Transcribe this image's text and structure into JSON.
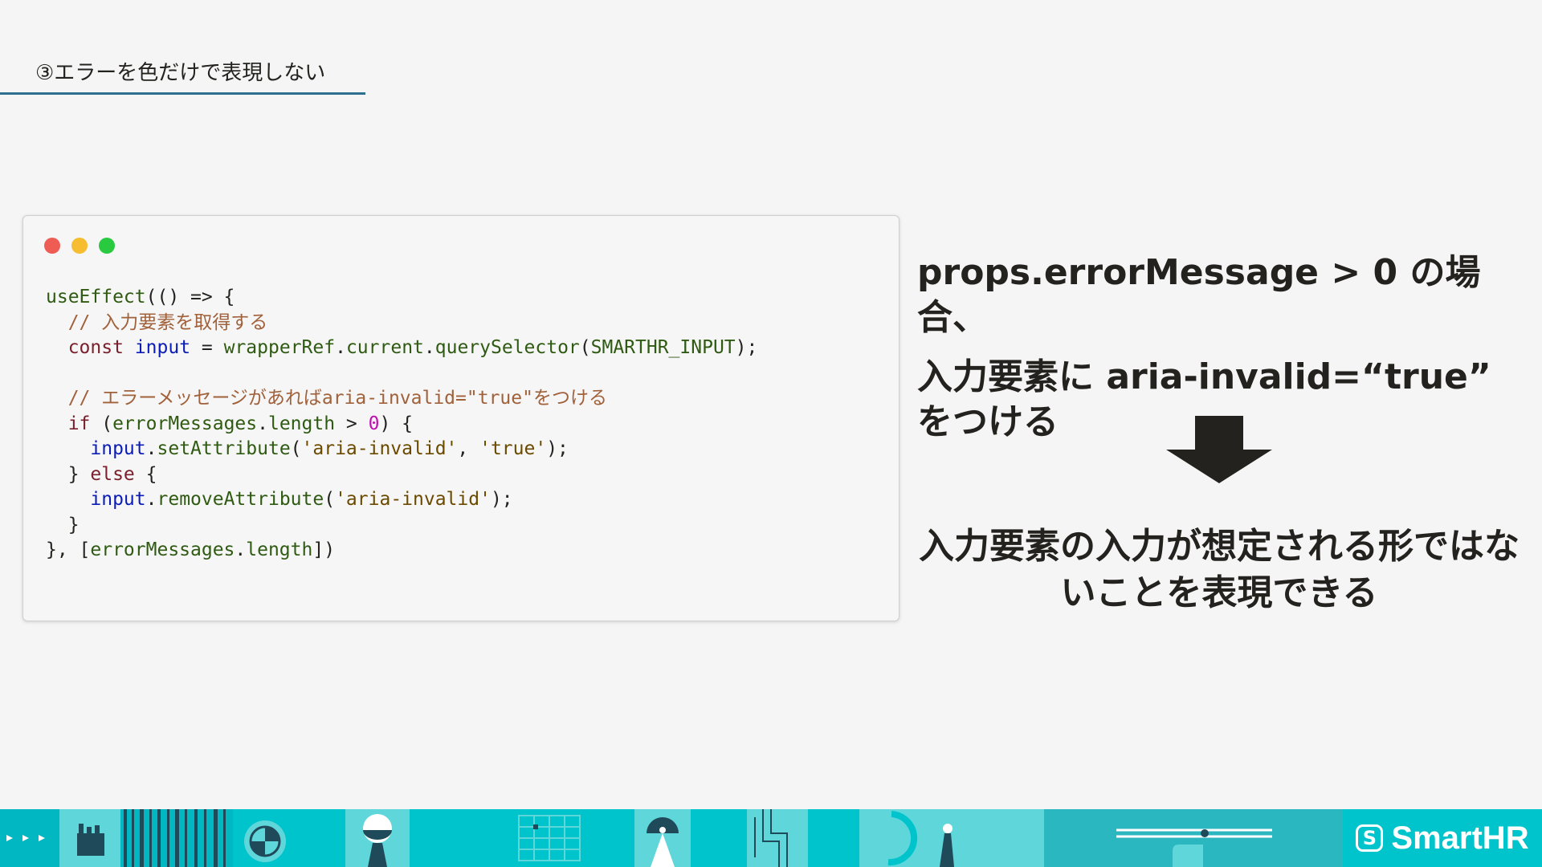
{
  "slide": {
    "section_title": "③エラーを色だけで表現しない"
  },
  "code_window": {
    "lines": [
      [
        {
          "t": "useEffect",
          "c": "fn"
        },
        {
          "t": "(() => {",
          "c": ""
        }
      ],
      [
        {
          "t": "  // 入力要素を取得する",
          "c": "cm"
        }
      ],
      [
        {
          "t": "  ",
          "c": ""
        },
        {
          "t": "const",
          "c": "kw"
        },
        {
          "t": " ",
          "c": ""
        },
        {
          "t": "input",
          "c": "var"
        },
        {
          "t": " = ",
          "c": ""
        },
        {
          "t": "wrapperRef",
          "c": "fn"
        },
        {
          "t": ".",
          "c": ""
        },
        {
          "t": "current",
          "c": "fn"
        },
        {
          "t": ".",
          "c": ""
        },
        {
          "t": "querySelector",
          "c": "fn"
        },
        {
          "t": "(",
          "c": ""
        },
        {
          "t": "SMARTHR_INPUT",
          "c": "fn"
        },
        {
          "t": ");",
          "c": ""
        }
      ],
      [
        {
          "t": "",
          "c": ""
        }
      ],
      [
        {
          "t": "  // エラーメッセージがあればaria-invalid=\"true\"をつける",
          "c": "cm"
        }
      ],
      [
        {
          "t": "  ",
          "c": ""
        },
        {
          "t": "if",
          "c": "kw"
        },
        {
          "t": " (",
          "c": ""
        },
        {
          "t": "errorMessages",
          "c": "fn"
        },
        {
          "t": ".",
          "c": ""
        },
        {
          "t": "length",
          "c": "fn"
        },
        {
          "t": " > ",
          "c": ""
        },
        {
          "t": "0",
          "c": "num"
        },
        {
          "t": ") {",
          "c": ""
        }
      ],
      [
        {
          "t": "    ",
          "c": ""
        },
        {
          "t": "input",
          "c": "var"
        },
        {
          "t": ".",
          "c": ""
        },
        {
          "t": "setAttribute",
          "c": "fn"
        },
        {
          "t": "(",
          "c": ""
        },
        {
          "t": "'aria-invalid'",
          "c": "str"
        },
        {
          "t": ", ",
          "c": ""
        },
        {
          "t": "'true'",
          "c": "str"
        },
        {
          "t": ");",
          "c": ""
        }
      ],
      [
        {
          "t": "  } ",
          "c": ""
        },
        {
          "t": "else",
          "c": "kw"
        },
        {
          "t": " {",
          "c": ""
        }
      ],
      [
        {
          "t": "    ",
          "c": ""
        },
        {
          "t": "input",
          "c": "var"
        },
        {
          "t": ".",
          "c": ""
        },
        {
          "t": "removeAttribute",
          "c": "fn"
        },
        {
          "t": "(",
          "c": ""
        },
        {
          "t": "'aria-invalid'",
          "c": "str"
        },
        {
          "t": ");",
          "c": ""
        }
      ],
      [
        {
          "t": "  }",
          "c": ""
        }
      ],
      [
        {
          "t": "}, [",
          "c": ""
        },
        {
          "t": "errorMessages",
          "c": "fn"
        },
        {
          "t": ".",
          "c": ""
        },
        {
          "t": "length",
          "c": "fn"
        },
        {
          "t": "])",
          "c": ""
        }
      ]
    ]
  },
  "explanation": {
    "line1": "props.errorMessage > 0 の場合、",
    "line2": "入力要素に aria-invalid=“true” をつける",
    "result": "入力要素の入力が想定される形ではないことを表現できる"
  },
  "footer": {
    "logo_mark": "S",
    "logo_text": "SmartHR"
  },
  "colors": {
    "accent": "#00c4cc",
    "underline": "#2e6e8e",
    "text": "#23221e"
  }
}
